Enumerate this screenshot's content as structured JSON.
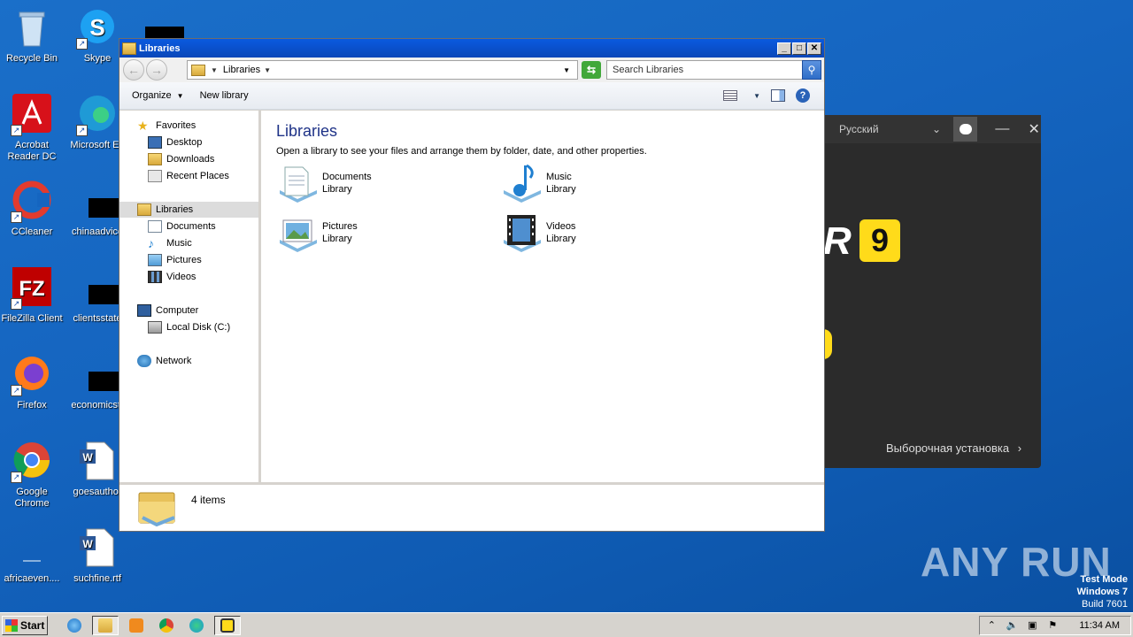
{
  "desktop": {
    "icons": [
      {
        "label": "Recycle Bin"
      },
      {
        "label": "Skype"
      },
      {
        "label": "Acrobat Reader DC"
      },
      {
        "label": "Microsoft Ed"
      },
      {
        "label": "CCleaner"
      },
      {
        "label": "chinaadvice"
      },
      {
        "label": "FileZilla Client"
      },
      {
        "label": "clientsstate"
      },
      {
        "label": "Firefox"
      },
      {
        "label": "economicstr"
      },
      {
        "label": "Google Chrome"
      },
      {
        "label": "goesauthor"
      },
      {
        "label": "africaeven...."
      },
      {
        "label": "suchfine.rtf"
      }
    ]
  },
  "installer": {
    "language": "Русский",
    "brand_fragment": "R",
    "version_badge": "9",
    "custom_install": "Выборочная установка"
  },
  "window": {
    "title": "Libraries",
    "address": {
      "crumb": "Libraries"
    },
    "search": {
      "placeholder": "Search Libraries"
    },
    "toolbar": {
      "organize": "Organize",
      "new_library": "New library"
    },
    "nav": {
      "favorites": "Favorites",
      "desktop": "Desktop",
      "downloads": "Downloads",
      "recent": "Recent Places",
      "libraries": "Libraries",
      "documents": "Documents",
      "music": "Music",
      "pictures": "Pictures",
      "videos": "Videos",
      "computer": "Computer",
      "local_disk": "Local Disk (C:)",
      "network": "Network"
    },
    "content": {
      "heading": "Libraries",
      "description": "Open a library to see your files and arrange them by folder, date, and other properties.",
      "libraries": [
        {
          "name": "Documents",
          "type": "Library",
          "icon": "documents-library-icon"
        },
        {
          "name": "Music",
          "type": "Library",
          "icon": "music-library-icon"
        },
        {
          "name": "Pictures",
          "type": "Library",
          "icon": "pictures-library-icon"
        },
        {
          "name": "Videos",
          "type": "Library",
          "icon": "videos-library-icon"
        }
      ]
    },
    "status": {
      "count": "4 items"
    }
  },
  "taskbar": {
    "start": "Start",
    "clock": "11:34 AM"
  },
  "watermark": "ANY RUN",
  "testmode": {
    "line1": "Test Mode",
    "line2": "Windows 7",
    "line3": "Build 7601"
  },
  "colors": {
    "titlebar": "#0a5ae0",
    "heading": "#1e3287",
    "installer_bg": "#2b2b2b",
    "accent_yellow": "#ffdb1a"
  }
}
